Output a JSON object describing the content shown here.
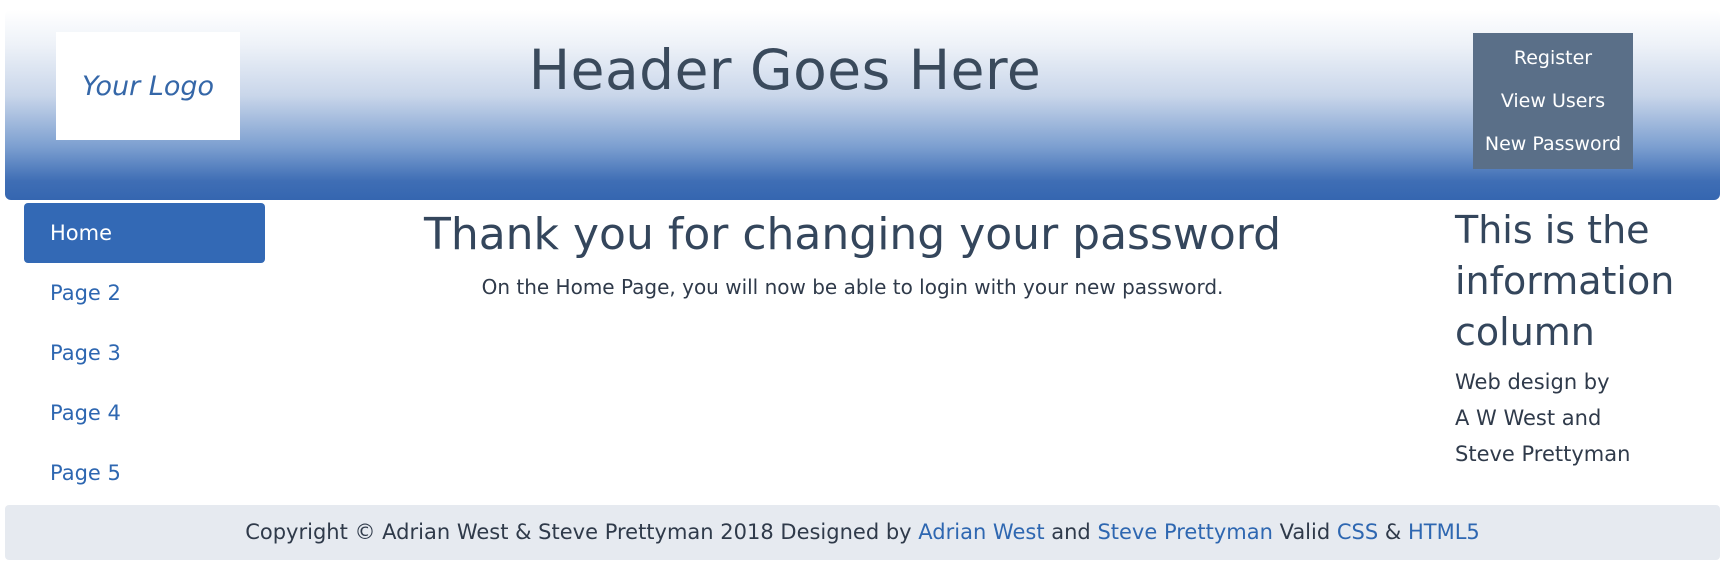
{
  "header": {
    "logo_text": "Your Logo",
    "title": "Header Goes Here",
    "menu": [
      "Register",
      "View Users",
      "New Password"
    ]
  },
  "sidebar": {
    "items": [
      {
        "label": "Home",
        "active": true
      },
      {
        "label": "Page 2",
        "active": false
      },
      {
        "label": "Page 3",
        "active": false
      },
      {
        "label": "Page 4",
        "active": false
      },
      {
        "label": "Page 5",
        "active": false
      }
    ]
  },
  "main": {
    "heading": "Thank you for changing your password",
    "message": "On the Home Page, you will now be able to login with your new password."
  },
  "info": {
    "heading": "This is the information column",
    "lines": [
      "Web design by",
      "A W West and",
      "Steve Prettyman"
    ]
  },
  "footer": {
    "copyright": "Copyright © Adrian West & Steve Prettyman 2018 Designed by",
    "link1": "Adrian West",
    "and": "and",
    "link2": "Steve Prettyman",
    "valid": "Valid",
    "css": "CSS",
    "amp": "&",
    "html5": "HTML5"
  },
  "colors": {
    "accent": "#3369b5",
    "link": "#2e67b1",
    "menu_bg": "#5a6f88",
    "footer_bg": "#e6eaf0"
  }
}
